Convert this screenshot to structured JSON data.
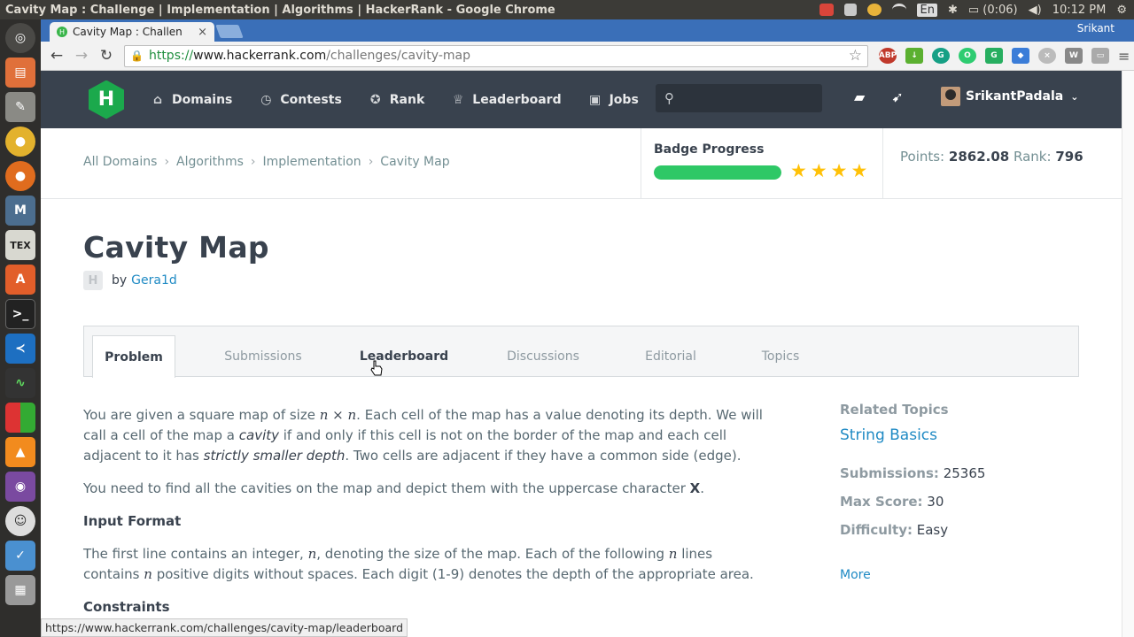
{
  "os": {
    "window_title": "Cavity Map : Challenge | Implementation | Algorithms | HackerRank - Google Chrome",
    "battery": "(0:06)",
    "keyboard": "En",
    "clock": "10:12 PM"
  },
  "browser": {
    "tab_title": "Cavity Map : Challen",
    "profile": "Srikant",
    "url_scheme": "https://",
    "url_host": "www.hackerrank.com",
    "url_path": "/challenges/cavity-map",
    "status_url": "https://www.hackerrank.com/challenges/cavity-map/leaderboard"
  },
  "nav": {
    "logo": "H",
    "items": [
      {
        "label": "Domains",
        "icon": "home-icon"
      },
      {
        "label": "Contests",
        "icon": "clock-icon"
      },
      {
        "label": "Rank",
        "icon": "medal-icon"
      },
      {
        "label": "Leaderboard",
        "icon": "trophy-icon"
      },
      {
        "label": "Jobs",
        "icon": "briefcase-icon"
      }
    ],
    "username": "SrikantPadala"
  },
  "breadcrumbs": [
    "All Domains",
    "Algorithms",
    "Implementation",
    "Cavity Map"
  ],
  "badge": {
    "label": "Badge Progress",
    "progress_fraction": 1.0,
    "stars": 4
  },
  "stats_bar": {
    "points_label": "Points:",
    "points": "2862.08",
    "rank_label": "Rank:",
    "rank": "796"
  },
  "challenge": {
    "title": "Cavity Map",
    "by": "by",
    "author": "Gera1d"
  },
  "tabs": [
    "Problem",
    "Submissions",
    "Leaderboard",
    "Discussions",
    "Editorial",
    "Topics"
  ],
  "problem": {
    "p1_a": "You are given a square map of size ",
    "p1_b": ". Each cell of the map has a value denoting its depth. We will call a cell of the map a ",
    "p1_cavity": "cavity",
    "p1_c": " if and only if this cell is not on the border of the map and each cell adjacent to it has ",
    "p1_strict": "strictly smaller depth",
    "p1_d": ". Two cells are adjacent if they have a common side (edge).",
    "p2_a": "You need to find all the cavities on the map and depict them with the uppercase character ",
    "p2_x": "X",
    "p2_b": ".",
    "input_heading": "Input Format",
    "p3_a": "The first line contains an integer, ",
    "p3_b": ", denoting the size of the map. Each of the following ",
    "p3_c": " lines contains ",
    "p3_d": " positive digits without spaces. Each digit (1-9) denotes the depth of the appropriate area.",
    "constraints_heading": "Constraints",
    "math_n": "n",
    "math_nxn": "n × n"
  },
  "sidebar": {
    "related_heading": "Related Topics",
    "related_link": "String Basics",
    "submissions_label": "Submissions:",
    "submissions": "25365",
    "max_score_label": "Max Score:",
    "max_score": "30",
    "difficulty_label": "Difficulty:",
    "difficulty": "Easy",
    "more": "More"
  }
}
